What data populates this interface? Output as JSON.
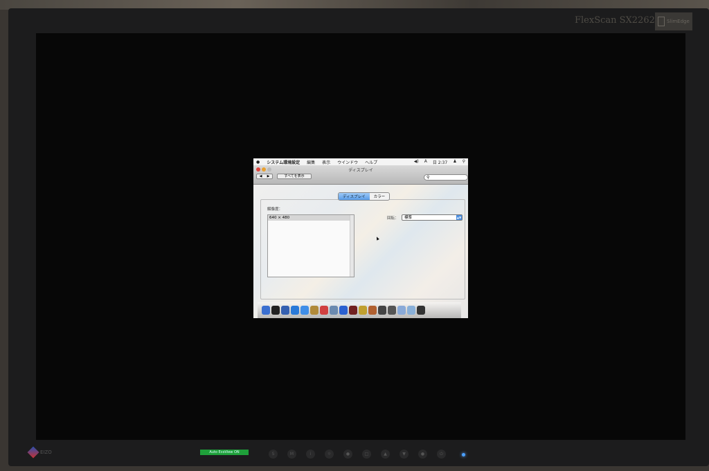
{
  "monitor": {
    "model": "FlexScan SX2262W",
    "badge": "SlimEdge",
    "brand": "EIZO",
    "eco_label": "Auto EcoView ON",
    "buttons": [
      "S",
      "M",
      "i",
      "☼",
      "●",
      "□",
      "▲",
      "▼",
      "●",
      "⏻"
    ]
  },
  "menubar": {
    "app": "システム環境設定",
    "items": [
      "編集",
      "表示",
      "ウインドウ",
      "ヘルプ"
    ],
    "clock": "日 2:37"
  },
  "window": {
    "title": "ディスプレイ",
    "show_all": "すべてを表示",
    "search_placeholder": "",
    "tabs": [
      "ディスプレイ",
      "カラー"
    ],
    "resolution_label": "解像度：",
    "resolutions": [
      "640 × 480"
    ],
    "rotation_label": "回転：",
    "rotation_value": "標準"
  },
  "dock": {
    "colors": [
      "#3a6fd0",
      "#222",
      "#3560b0",
      "#2a7ad8",
      "#3f8ee8",
      "#b08a3a",
      "#d04040",
      "#6a8ab0",
      "#2a60d0",
      "#702020",
      "#c0a030",
      "#b06030",
      "#444",
      "#555",
      "#8aaad8",
      "#8ab0d8",
      "#333"
    ]
  }
}
